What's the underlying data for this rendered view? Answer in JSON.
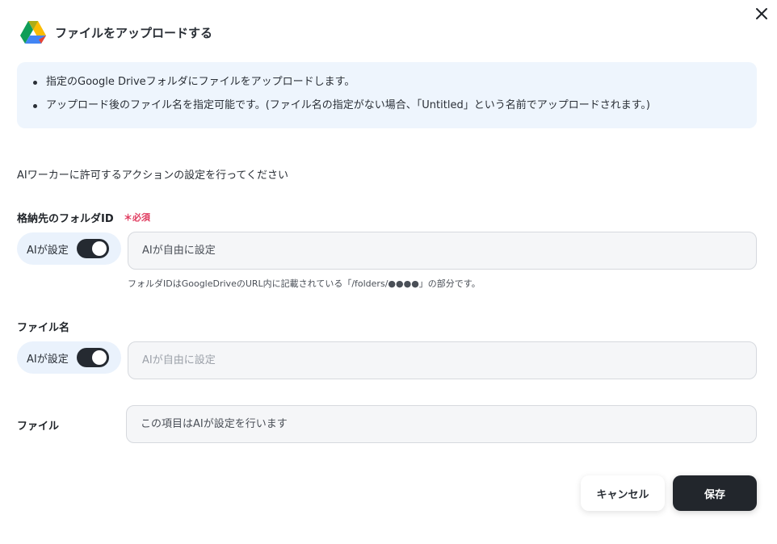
{
  "dialog": {
    "title": "ファイルをアップロードする",
    "logo_icon": "google-drive-icon",
    "close_icon": "close-icon"
  },
  "info": {
    "items": [
      "指定のGoogle Driveフォルダにファイルをアップロードします。",
      "アップロード後のファイル名を指定可能です。(ファイル名の指定がない場合、「Untitled」という名前でアップロードされます。)"
    ]
  },
  "description": "AIワーカーに許可するアクションの設定を行ってください",
  "fields": {
    "folder_id": {
      "label": "格納先のフォルダID",
      "required_label": "必須",
      "ai_label": "AIが設定",
      "ai_enabled": true,
      "value": "AIが自由に設定",
      "hint": "フォルダIDはGoogleDriveのURL内に記載されている「/folders/●●●●」の部分です。"
    },
    "file_name": {
      "label": "ファイル名",
      "ai_label": "AIが設定",
      "ai_enabled": true,
      "placeholder": "AIが自由に設定"
    },
    "file": {
      "label": "ファイル",
      "value": "この項目はAIが設定を行います"
    }
  },
  "buttons": {
    "cancel": "キャンセル",
    "save": "保存"
  },
  "colors": {
    "info_bg": "#eef5fd",
    "pill_bg": "#eaf2fc",
    "toggle_on": "#252a31",
    "required": "#e03a5e",
    "primary_button": "#22262c"
  }
}
